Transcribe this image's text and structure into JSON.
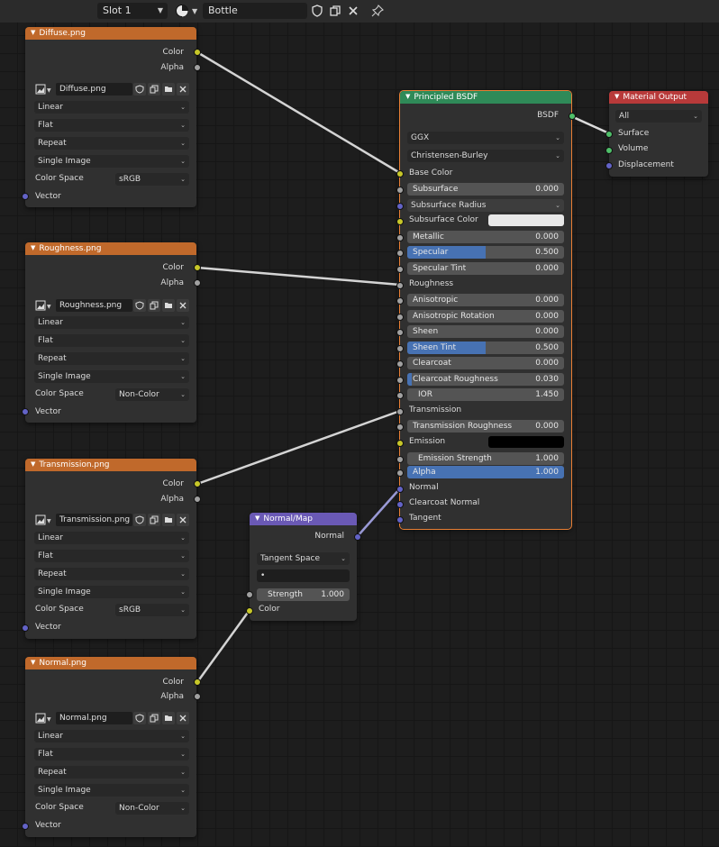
{
  "header": {
    "slot": "Slot 1",
    "material_name": "Bottle"
  },
  "image_nodes": [
    {
      "title": "Diffuse.png",
      "color": "Color",
      "alpha": "Alpha",
      "image": "Diffuse.png",
      "interpolation": "Linear",
      "projection": "Flat",
      "extension": "Repeat",
      "source": "Single Image",
      "color_space_label": "Color Space",
      "color_space": "sRGB",
      "vector": "Vector"
    },
    {
      "title": "Roughness.png",
      "color": "Color",
      "alpha": "Alpha",
      "image": "Roughness.png",
      "interpolation": "Linear",
      "projection": "Flat",
      "extension": "Repeat",
      "source": "Single Image",
      "color_space_label": "Color Space",
      "color_space": "Non-Color",
      "vector": "Vector"
    },
    {
      "title": "Transmission.png",
      "color": "Color",
      "alpha": "Alpha",
      "image": "Transmission.png",
      "interpolation": "Linear",
      "projection": "Flat",
      "extension": "Repeat",
      "source": "Single Image",
      "color_space_label": "Color Space",
      "color_space": "sRGB",
      "vector": "Vector"
    },
    {
      "title": "Normal.png",
      "color": "Color",
      "alpha": "Alpha",
      "image": "Normal.png",
      "interpolation": "Linear",
      "projection": "Flat",
      "extension": "Repeat",
      "source": "Single Image",
      "color_space_label": "Color Space",
      "color_space": "Non-Color",
      "vector": "Vector"
    }
  ],
  "bsdf": {
    "title": "Principled BSDF",
    "output": "BSDF",
    "distribution": "GGX",
    "subsurface_method": "Christensen-Burley",
    "base_color": "Base Color",
    "subsurface": {
      "label": "Subsurface",
      "value": "0.000",
      "fraction": 0
    },
    "subsurface_radius": "Subsurface Radius",
    "subsurface_color": "Subsurface Color",
    "subsurface_color_value": "#e8e8e8",
    "metallic": {
      "label": "Metallic",
      "value": "0.000",
      "fraction": 0
    },
    "specular": {
      "label": "Specular",
      "value": "0.500",
      "fraction": 0.5
    },
    "specular_tint": {
      "label": "Specular Tint",
      "value": "0.000",
      "fraction": 0
    },
    "roughness": "Roughness",
    "anisotropic": {
      "label": "Anisotropic",
      "value": "0.000",
      "fraction": 0
    },
    "anisotropic_rotation": {
      "label": "Anisotropic Rotation",
      "value": "0.000",
      "fraction": 0
    },
    "sheen": {
      "label": "Sheen",
      "value": "0.000",
      "fraction": 0
    },
    "sheen_tint": {
      "label": "Sheen Tint",
      "value": "0.500",
      "fraction": 0.5
    },
    "clearcoat": {
      "label": "Clearcoat",
      "value": "0.000",
      "fraction": 0
    },
    "clearcoat_roughness": {
      "label": "Clearcoat Roughness",
      "value": "0.030",
      "fraction": 0.03
    },
    "ior": {
      "label": "IOR",
      "value": "1.450",
      "fraction": 0
    },
    "transmission": "Transmission",
    "transmission_roughness": {
      "label": "Transmission Roughness",
      "value": "0.000",
      "fraction": 0
    },
    "emission": "Emission",
    "emission_color_value": "#000000",
    "emission_strength": {
      "label": "Emission Strength",
      "value": "1.000",
      "fraction": 0
    },
    "alpha": {
      "label": "Alpha",
      "value": "1.000",
      "fraction": 1
    },
    "normal": "Normal",
    "clearcoat_normal": "Clearcoat Normal",
    "tangent": "Tangent"
  },
  "material_output": {
    "title": "Material Output",
    "target": "All",
    "surface": "Surface",
    "volume": "Volume",
    "displacement": "Displacement"
  },
  "normal_map": {
    "title": "Normal/Map",
    "output": "Normal",
    "space": "Tangent Space",
    "uv": "•",
    "strength": {
      "label": "Strength",
      "value": "1.000"
    },
    "color": "Color"
  },
  "colors": {
    "image_header": "#c0692b",
    "bsdf_header": "#2f8a58",
    "normal_map_header": "#6a59b5",
    "output_header": "#b83a3a",
    "slider_fill": "#4772b3",
    "socket_color": "#c7c729",
    "socket_float": "#a1a1a1",
    "socket_vector": "#6363c7",
    "socket_shader": "#4fbf69"
  }
}
